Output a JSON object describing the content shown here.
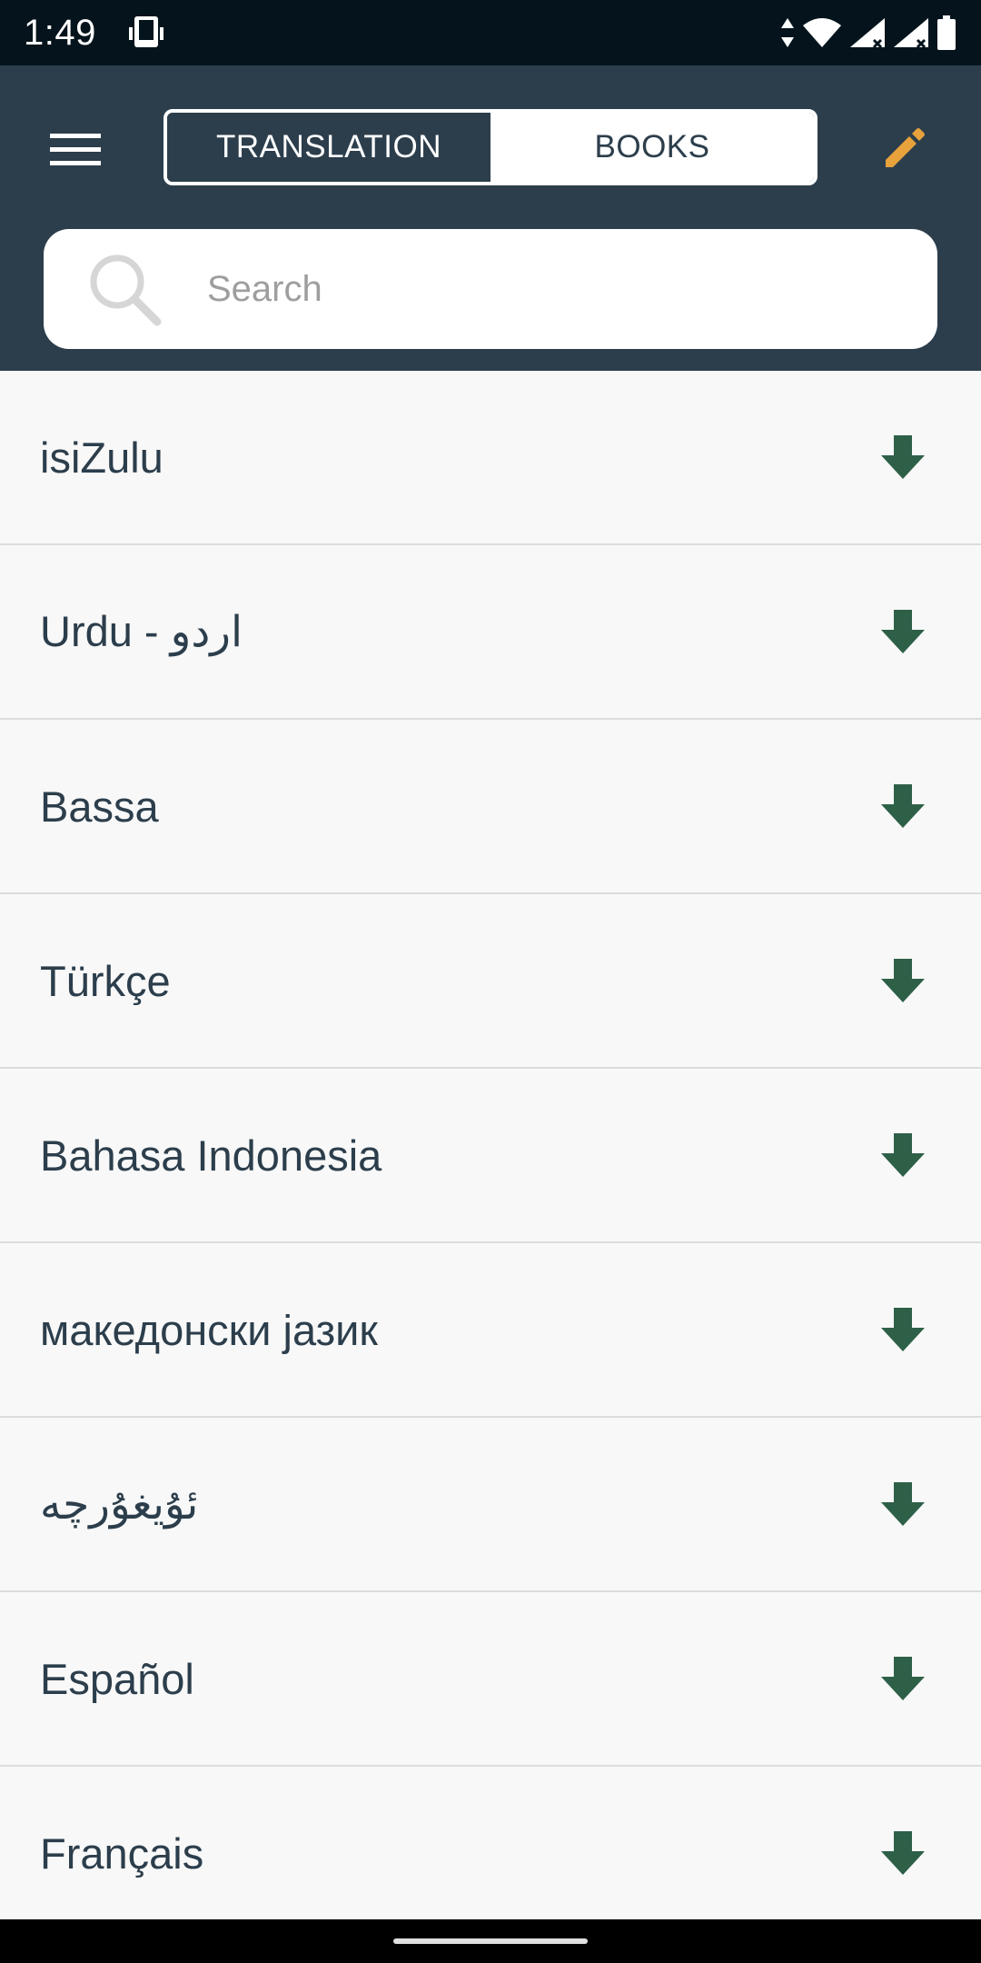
{
  "status_bar": {
    "time": "1:49"
  },
  "header": {
    "tabs": [
      {
        "label": "TRANSLATION",
        "active": true
      },
      {
        "label": "BOOKS",
        "active": false
      }
    ],
    "icons": {
      "menu": "hamburger-menu-icon",
      "edit": "pencil-icon"
    },
    "accent_color": "#e8a23c",
    "background_color": "#2c3e4c"
  },
  "search": {
    "placeholder": "Search",
    "value": ""
  },
  "languages": [
    {
      "label": "isiZulu"
    },
    {
      "label": "Urdu - اردو"
    },
    {
      "label": "Bassa"
    },
    {
      "label": "Türkçe"
    },
    {
      "label": "Bahasa Indonesia"
    },
    {
      "label": "македонски јазик"
    },
    {
      "label": "ئۇيغۇرچە"
    },
    {
      "label": "Español"
    },
    {
      "label": "Français"
    }
  ],
  "download_icon_color": "#2e6048"
}
